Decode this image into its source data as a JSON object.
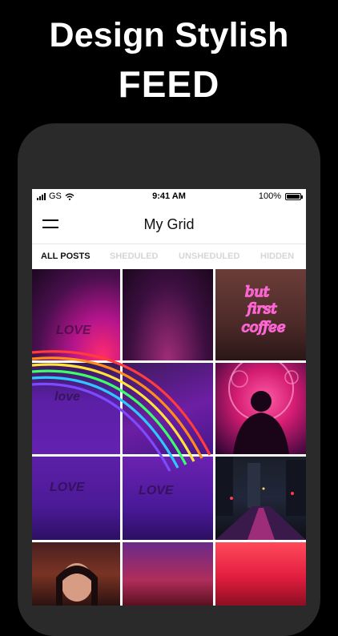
{
  "promo": {
    "line1": "Design Stylish",
    "line2": "FEED"
  },
  "status_bar": {
    "carrier": "GS",
    "time": "9:41 AM",
    "battery": "100%"
  },
  "navbar": {
    "title": "My Grid"
  },
  "tabs": [
    {
      "label": "ALL POSTS",
      "active": true
    },
    {
      "label": "SHEDULED",
      "active": false
    },
    {
      "label": "UNSHEDULED",
      "active": false
    },
    {
      "label": "HIDDEN",
      "active": false
    }
  ],
  "grid": {
    "neon_sign": [
      "but",
      "first",
      "coffee"
    ],
    "wall_words": [
      "LOVE",
      "LOVE",
      "LOVE"
    ]
  },
  "colors": {
    "background": "#000000",
    "phone_frame": "#2a2a2a",
    "tab_active": "#111111",
    "tab_inactive": "#d6d6d6"
  }
}
